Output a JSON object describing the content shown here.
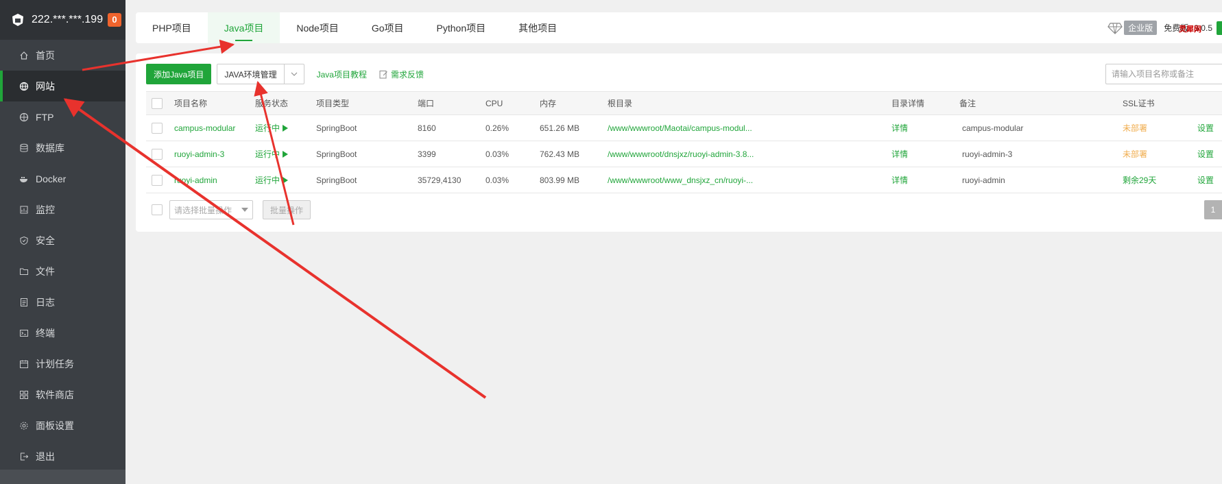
{
  "sidebar": {
    "ip": "222.***.***.199",
    "badge": "0",
    "items": [
      {
        "label": "首页",
        "icon": "home-icon"
      },
      {
        "label": "网站",
        "icon": "globe-icon"
      },
      {
        "label": "FTP",
        "icon": "ftp-icon"
      },
      {
        "label": "数据库",
        "icon": "database-icon"
      },
      {
        "label": "Docker",
        "icon": "docker-icon"
      },
      {
        "label": "监控",
        "icon": "monitor-icon"
      },
      {
        "label": "安全",
        "icon": "shield-icon"
      },
      {
        "label": "文件",
        "icon": "folder-icon"
      },
      {
        "label": "日志",
        "icon": "log-icon"
      },
      {
        "label": "终端",
        "icon": "terminal-icon"
      },
      {
        "label": "计划任务",
        "icon": "calendar-icon"
      },
      {
        "label": "软件商店",
        "icon": "apps-icon"
      },
      {
        "label": "面板设置",
        "icon": "settings-icon"
      },
      {
        "label": "退出",
        "icon": "logout-icon"
      }
    ]
  },
  "tabs": [
    "PHP项目",
    "Java项目",
    "Node项目",
    "Go项目",
    "Python项目",
    "其他项目"
  ],
  "header_right": {
    "enterprise": "企业版",
    "free": "免费版",
    "version": "8.0.5",
    "corner_logo": "灵犀网"
  },
  "toolbar": {
    "add": "添加Java项目",
    "env": "JAVA环境管理",
    "tutorial": "Java项目教程",
    "feedback": "需求反馈",
    "search_placeholder": "请输入项目名称或备注"
  },
  "table": {
    "headers": [
      "项目名称",
      "服务状态",
      "项目类型",
      "端口",
      "CPU",
      "内存",
      "根目录",
      "目录详情",
      "备注",
      "SSL证书"
    ],
    "rows": [
      {
        "name": "campus-modular",
        "status": "运行中",
        "type": "SpringBoot",
        "port": "8160",
        "cpu": "0.26%",
        "mem": "651.26 MB",
        "root": "/www/wwwroot/Maotai/campus-modul...",
        "detail": "详情",
        "note": "campus-modular",
        "ssl": "未部署",
        "action": "设置"
      },
      {
        "name": "ruoyi-admin-3",
        "status": "运行中",
        "type": "SpringBoot",
        "port": "3399",
        "cpu": "0.03%",
        "mem": "762.43 MB",
        "root": "/www/wwwroot/dnsjxz/ruoyi-admin-3.8...",
        "detail": "详情",
        "note": "ruoyi-admin-3",
        "ssl": "未部署",
        "action": "设置"
      },
      {
        "name": "ruoyi-admin",
        "status": "运行中",
        "type": "SpringBoot",
        "port": "35729,4130",
        "cpu": "0.03%",
        "mem": "803.99 MB",
        "root": "/www/wwwroot/www_dnsjxz_cn/ruoyi-...",
        "detail": "详情",
        "note": "ruoyi-admin",
        "ssl": "剩余29天",
        "action": "设置"
      }
    ]
  },
  "footer": {
    "batch_select": "请选择批量操作",
    "batch_btn": "批量操作",
    "page": "1"
  },
  "colors": {
    "accent": "#20a53a",
    "warning": "#f0ad4e",
    "annotation": "#e8322d"
  }
}
